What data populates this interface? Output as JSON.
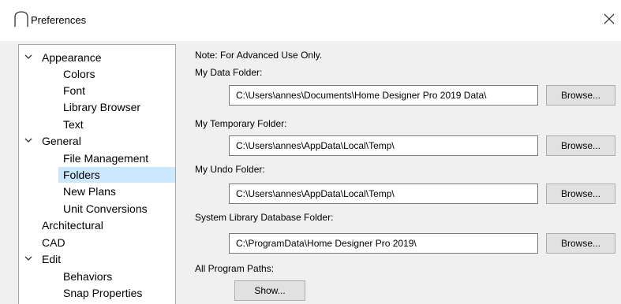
{
  "window": {
    "title": "Preferences",
    "app_icon": "arch-icon",
    "close_icon": "close-icon"
  },
  "tree": {
    "items": [
      {
        "label": "Appearance",
        "expandable": true,
        "expanded": true,
        "level": 0
      },
      {
        "label": "Colors",
        "level": 1
      },
      {
        "label": "Font",
        "level": 1
      },
      {
        "label": "Library Browser",
        "level": 1
      },
      {
        "label": "Text",
        "level": 1
      },
      {
        "label": "General",
        "expandable": true,
        "expanded": true,
        "level": 0
      },
      {
        "label": "File Management",
        "level": 1
      },
      {
        "label": "Folders",
        "level": 1,
        "selected": true
      },
      {
        "label": "New Plans",
        "level": 1
      },
      {
        "label": "Unit Conversions",
        "level": 1
      },
      {
        "label": "Architectural",
        "level": 0
      },
      {
        "label": "CAD",
        "level": 0
      },
      {
        "label": "Edit",
        "expandable": true,
        "expanded": true,
        "level": 0
      },
      {
        "label": "Behaviors",
        "level": 1
      },
      {
        "label": "Snap Properties",
        "level": 1
      }
    ],
    "selection_color": "#cce8ff"
  },
  "folders": {
    "note": "Note: For Advanced Use Only.",
    "data_folder_label": "My Data Folder:",
    "data_folder_value": "C:\\Users\\annes\\Documents\\Home Designer Pro 2019 Data\\",
    "temp_folder_label": "My Temporary Folder:",
    "temp_folder_value": "C:\\Users\\annes\\AppData\\Local\\Temp\\",
    "undo_folder_label": "My Undo Folder:",
    "undo_folder_value": "C:\\Users\\annes\\AppData\\Local\\Temp\\",
    "library_folder_label": "System Library Database Folder:",
    "library_folder_value": "C:\\ProgramData\\Home Designer Pro 2019\\",
    "browse_label": "Browse...",
    "program_paths_label": "All Program Paths:",
    "show_label": "Show..."
  }
}
